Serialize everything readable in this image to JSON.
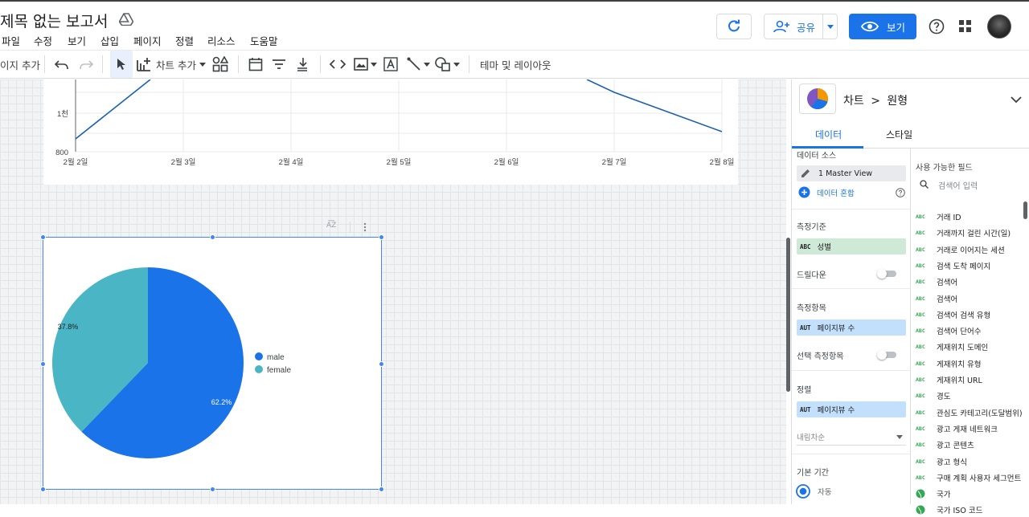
{
  "header": {
    "doc_title": "제목 없는 보고서",
    "share_label": "공유",
    "view_label": "보기"
  },
  "menu": [
    "파일",
    "수정",
    "보기",
    "삽입",
    "페이지",
    "정렬",
    "리소스",
    "도움말"
  ],
  "toolbar": {
    "add_page_label": "이지 추가",
    "add_chart_label": "차트 추가",
    "theme_label": "테마 및 레이아웃"
  },
  "line_chart": {
    "y_ticks": [
      "1천",
      "800"
    ],
    "x_ticks": [
      "2월 2일",
      "2월 3일",
      "2월 4일",
      "2월 5일",
      "2월 6일",
      "2월 7일",
      "2월 8일"
    ]
  },
  "chart_data": {
    "type": "pie",
    "categories": [
      "male",
      "female"
    ],
    "values": [
      62.2,
      37.8
    ],
    "labels": [
      "62.2%",
      "37.8%"
    ],
    "colors": [
      "#1a73e8",
      "#4ab5c4"
    ],
    "legend_position": "right"
  },
  "panel": {
    "breadcrumb_chart": "차트",
    "breadcrumb_sep": ">",
    "breadcrumb_type": "원형",
    "tab_data": "데이터",
    "tab_style": "스타일",
    "source_title": "데이터 소스",
    "source_value": "1 Master View",
    "blend_label": "데이터 혼합",
    "dimension_title": "측정기준",
    "dimension_type": "ABC",
    "dimension_value": "성별",
    "drilldown_label": "드릴다운",
    "metric_title": "측정항목",
    "metric_type": "AUT",
    "metric_value": "페이지뷰 수",
    "optional_metric_label": "선택 측정항목",
    "sort_title": "정렬",
    "sort_type": "AUT",
    "sort_value": "페이지뷰 수",
    "sort_order": "내림차순",
    "date_range_title": "기본 기간",
    "date_range_auto": "자동"
  },
  "fields": {
    "title": "사용 가능한 필드",
    "search_placeholder": "검색어 입력",
    "type_abc": "ABC",
    "items": [
      "거래 ID",
      "거래까지 걸린 시간(일)",
      "거래로 이어지는 세션",
      "검색 도착 페이지",
      "검색어",
      "검색어",
      "검색어 검색 유형",
      "검색어 단어수",
      "게재위치 도메인",
      "게재위치 유형",
      "게재위치 URL",
      "경도",
      "관심도 카테고리(도달범위)",
      "광고 게재 네트워크",
      "광고 콘텐츠",
      "광고 형식",
      "구매 계획 사용자 세그먼트",
      "국가",
      "국가 ISO 코드"
    ]
  }
}
